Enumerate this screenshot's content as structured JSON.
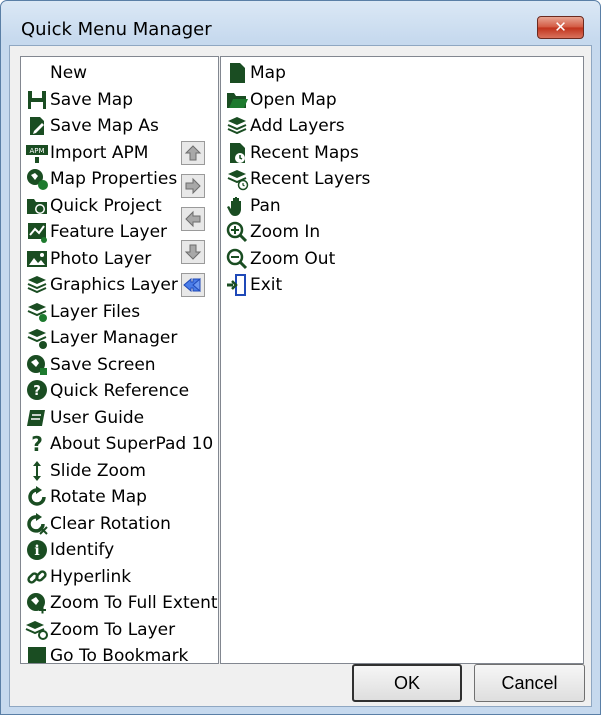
{
  "window": {
    "title": "Quick Menu Manager"
  },
  "left_list": [
    {
      "label": "New",
      "icon": "blank"
    },
    {
      "label": "Save Map",
      "icon": "floppy-icon"
    },
    {
      "label": "Save Map As",
      "icon": "save-as-icon"
    },
    {
      "label": "Import APM",
      "icon": "apm-icon"
    },
    {
      "label": "Map Properties",
      "icon": "map-properties-icon"
    },
    {
      "label": "Quick Project",
      "icon": "quick-project-icon"
    },
    {
      "label": "Feature Layer",
      "icon": "feature-layer-icon"
    },
    {
      "label": "Photo Layer",
      "icon": "photo-layer-icon"
    },
    {
      "label": "Graphics Layer",
      "icon": "graphics-layer-icon"
    },
    {
      "label": "Layer Files",
      "icon": "layer-files-icon"
    },
    {
      "label": "Layer Manager",
      "icon": "layer-manager-icon"
    },
    {
      "label": "Save Screen",
      "icon": "save-screen-icon"
    },
    {
      "label": "Quick Reference",
      "icon": "quick-reference-icon"
    },
    {
      "label": "User Guide",
      "icon": "user-guide-icon"
    },
    {
      "label": "About SuperPad 10",
      "icon": "question-icon"
    },
    {
      "label": "Slide Zoom",
      "icon": "slide-zoom-icon"
    },
    {
      "label": "Rotate Map",
      "icon": "rotate-icon"
    },
    {
      "label": "Clear Rotation",
      "icon": "clear-rotation-icon"
    },
    {
      "label": "Identify",
      "icon": "info-icon"
    },
    {
      "label": "Hyperlink",
      "icon": "hyperlink-icon"
    },
    {
      "label": "Zoom To Full Extent",
      "icon": "zoom-full-icon"
    },
    {
      "label": "Zoom To Layer",
      "icon": "zoom-layer-icon"
    },
    {
      "label": "Go To Bookmark",
      "icon": "bookmark-icon"
    }
  ],
  "right_list": [
    {
      "label": "Map",
      "icon": "map-icon"
    },
    {
      "label": "Open Map",
      "icon": "open-folder-icon"
    },
    {
      "label": "Add Layers",
      "icon": "add-layers-icon"
    },
    {
      "label": "Recent Maps",
      "icon": "recent-maps-icon"
    },
    {
      "label": "Recent Layers",
      "icon": "recent-layers-icon"
    },
    {
      "label": "Pan",
      "icon": "hand-icon"
    },
    {
      "label": "Zoom In",
      "icon": "zoom-in-icon"
    },
    {
      "label": "Zoom Out",
      "icon": "zoom-out-icon"
    },
    {
      "label": "Exit",
      "icon": "exit-icon"
    }
  ],
  "buttons": {
    "ok": "OK",
    "cancel": "Cancel"
  },
  "colors": {
    "icon_green": "#1d7a2e",
    "icon_dark": "#1a4d22",
    "arrow_gray": "#9a9a9a",
    "arrow_blue": "#3b6fe0"
  }
}
